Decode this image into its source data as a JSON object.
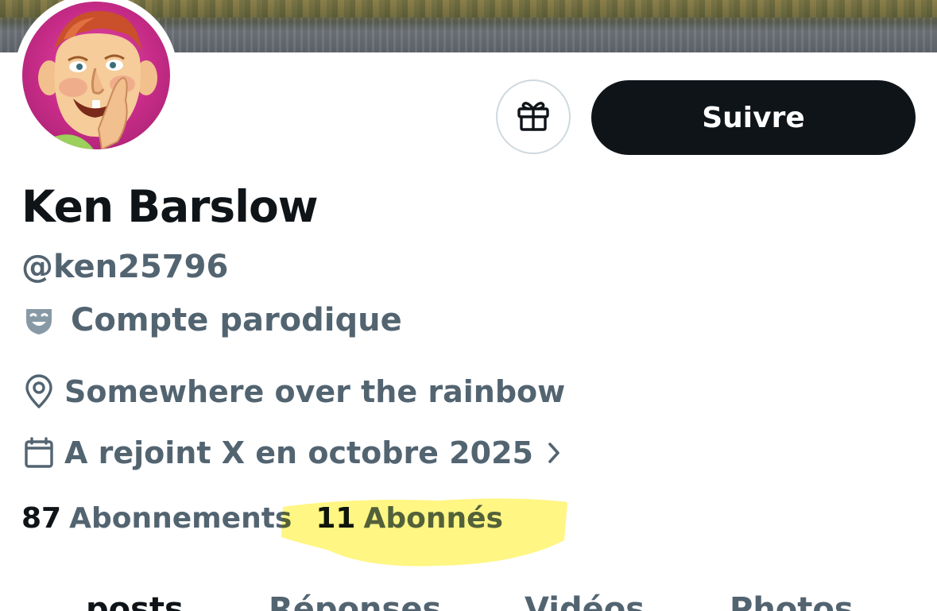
{
  "profile": {
    "display_name": "Ken Barslow",
    "handle": "@ken25796",
    "parody_label": "Compte parodique",
    "location": "Somewhere over the rainbow",
    "joined": "A rejoint X en octobre 2025"
  },
  "actions": {
    "follow_label": "Suivre"
  },
  "stats": {
    "following_count": "87",
    "following_label": "Abonnements",
    "followers_count": "11",
    "followers_label": "Abonnés"
  },
  "tabs": [
    {
      "label": "posts"
    },
    {
      "label": "Réponses"
    },
    {
      "label": "Vidéos"
    },
    {
      "label": "Photos"
    }
  ],
  "icons": {
    "gift": "gift-icon",
    "parody": "theater-mask-icon",
    "location": "location-pin-icon",
    "calendar": "calendar-icon",
    "chevron": "chevron-right-icon"
  },
  "colors": {
    "primary_text": "#0f1419",
    "secondary_text": "#536471",
    "follow_button_bg": "#0f1419",
    "highlight": "#fff35a"
  }
}
